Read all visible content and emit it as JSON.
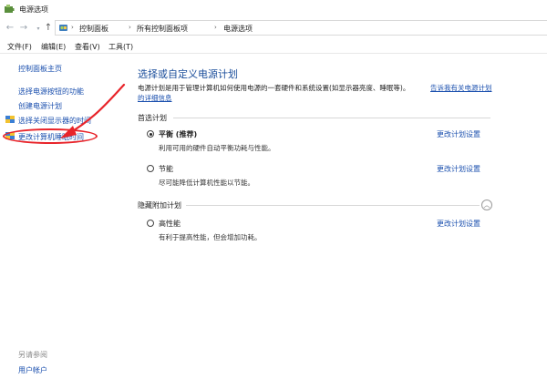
{
  "window": {
    "title": "电源选项"
  },
  "breadcrumb": [
    "控制面板",
    "所有控制面板项",
    "电源选项"
  ],
  "menu": [
    "文件(F)",
    "编辑(E)",
    "查看(V)",
    "工具(T)"
  ],
  "sidebar": {
    "items": [
      {
        "label": "控制面板主页"
      },
      {
        "label": "选择电源按钮的功能"
      },
      {
        "label": "创建电源计划"
      },
      {
        "label": "选择关闭显示器的时间"
      },
      {
        "label": "更改计算机睡眠时间"
      }
    ],
    "see_also": "另请参阅",
    "user_accounts": "用户帐户"
  },
  "main": {
    "title": "选择或自定义电源计划",
    "description": "电源计划是用于管理计算机如何使用电源的一套硬件和系统设置(如显示器亮度、睡眠等)。",
    "link_line1": "告诉我有关电源计划",
    "link_line2": "的详细信息",
    "preferred_header": "首选计划",
    "hidden_header": "隐藏附加计划",
    "plans": [
      {
        "name": "平衡 (推荐)",
        "desc": "利用可用的硬件自动平衡功耗与性能。",
        "link": "更改计划设置",
        "selected": true
      },
      {
        "name": "节能",
        "desc": "尽可能降低计算机性能以节能。",
        "link": "更改计划设置",
        "selected": false
      },
      {
        "name": "高性能",
        "desc": "有利于提高性能，但会增加功耗。",
        "link": "更改计划设置",
        "selected": false
      }
    ]
  },
  "colors": {
    "link": "#1a4fae",
    "title": "#1b4e9b",
    "annotation": "#e8242a"
  }
}
